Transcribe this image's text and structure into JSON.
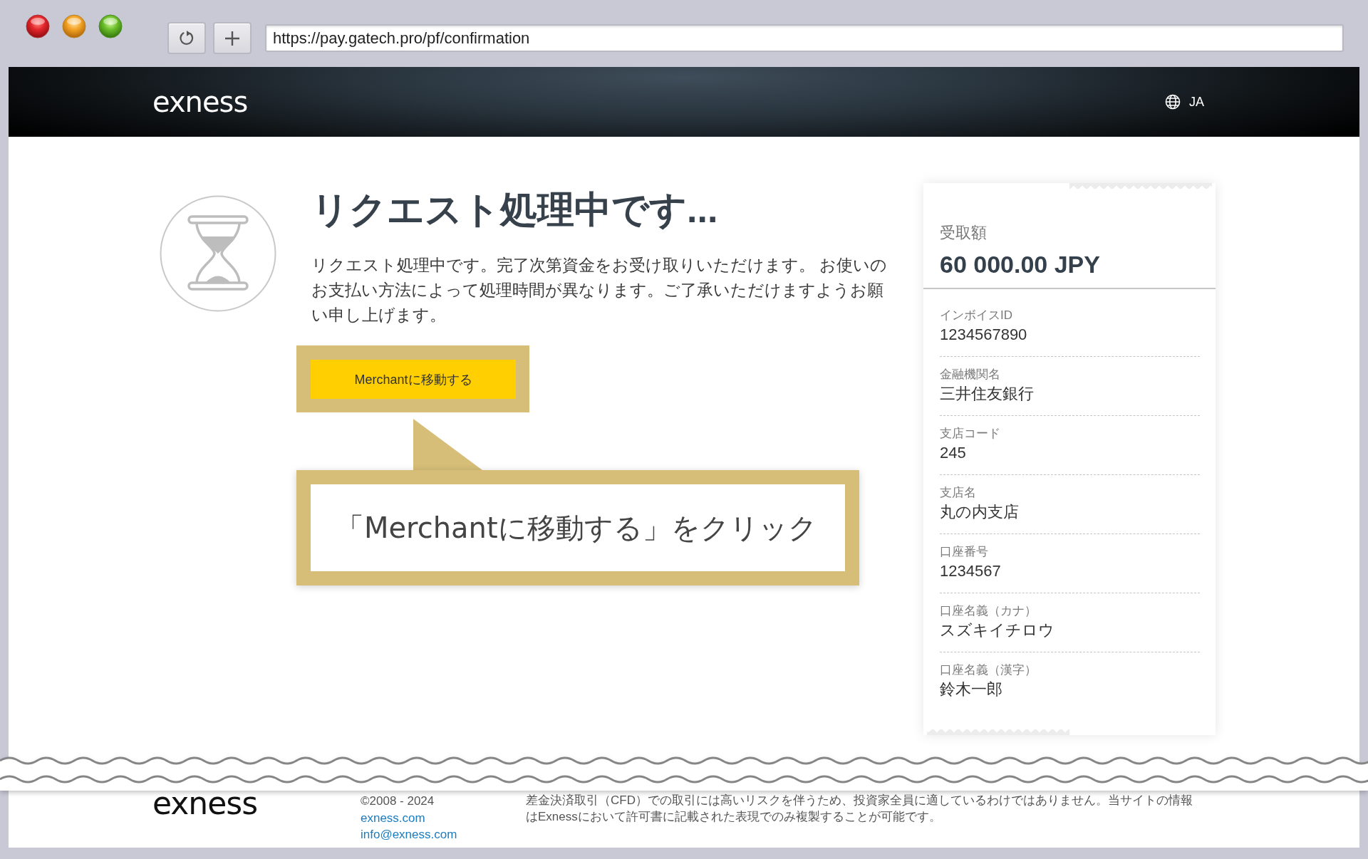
{
  "browser": {
    "url": "https://pay.gatech.pro/pf/confirmation"
  },
  "header": {
    "logo": "exness",
    "language": "JA"
  },
  "status": {
    "title": "リクエスト処理中です...",
    "message": "リクエスト処理中です。完了次第資金をお受け取りいただけます。 お使いのお支払い方法によって処理時間が異なります。ご了承いただけますようお願い申し上げます。",
    "button": "Merchantに移動する"
  },
  "callout": {
    "text": "「Merchantに移動する」をクリック"
  },
  "receipt": {
    "amount_label": "受取額",
    "amount": "60 000.00 JPY",
    "fields": [
      {
        "label": "インボイスID",
        "value": "1234567890"
      },
      {
        "label": "金融機関名",
        "value": "三井住友銀行"
      },
      {
        "label": "支店コード",
        "value": "245"
      },
      {
        "label": "支店名",
        "value": "丸の内支店"
      },
      {
        "label": "口座番号",
        "value": "1234567"
      },
      {
        "label": "口座名義（カナ）",
        "value": "スズキイチロウ"
      },
      {
        "label": "口座名義（漢字）",
        "value": "鈴木一郎"
      }
    ]
  },
  "footer": {
    "logo": "exness",
    "copyright": "©2008 - 2024",
    "links": [
      "exness.com",
      "info@exness.com"
    ],
    "disclaimer": "差金決済取引（CFD）での取引には高いリスクを伴うため、投資家全員に適しているわけではありません。当サイトの情報はExnessにおいて許可書に記載された表現でのみ複製することが可能です。"
  }
}
